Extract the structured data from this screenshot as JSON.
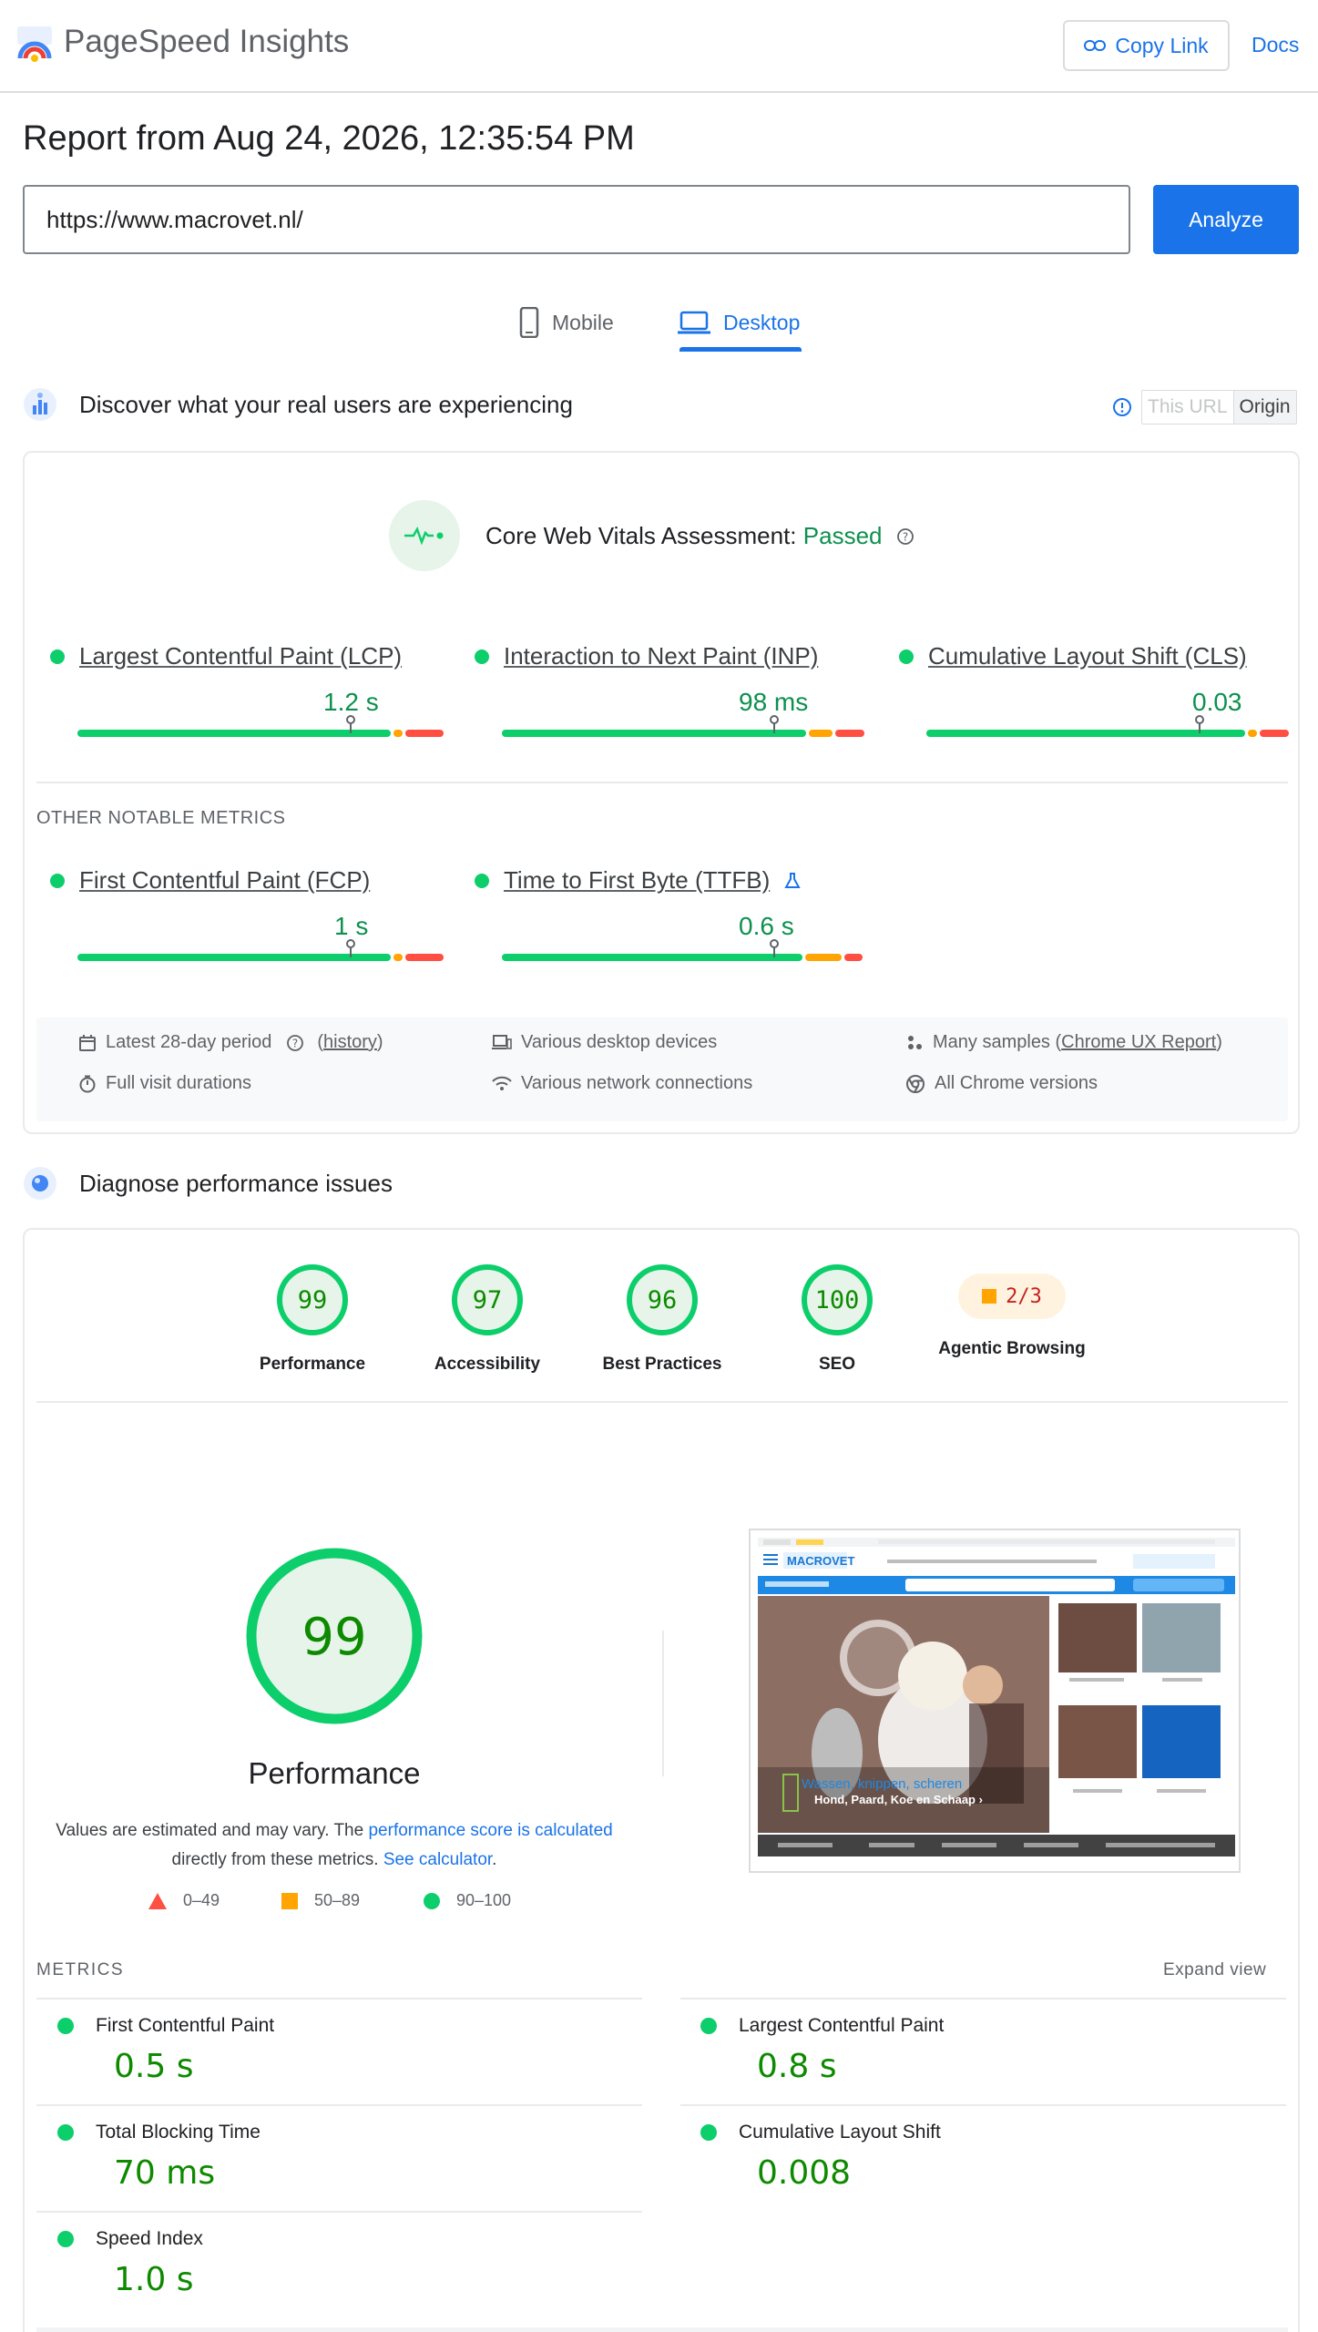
{
  "header": {
    "title": "PageSpeed Insights",
    "copy_link": "Copy Link",
    "docs": "Docs"
  },
  "report": {
    "title": "Report from Aug 24, 2026, 12:35:54 PM",
    "url": "https://www.macrovet.nl/",
    "analyze": "Analyze"
  },
  "tabs": {
    "mobile": "Mobile",
    "desktop": "Desktop",
    "active": "desktop"
  },
  "field": {
    "heading": "Discover what your real users are experiencing",
    "toggle_this_url": "This URL",
    "toggle_origin": "Origin",
    "assessment_label": "Core Web Vitals Assessment:",
    "assessment_status": "Passed",
    "metrics": [
      {
        "name": "Largest Contentful Paint (LCP)",
        "value": "1.2 s"
      },
      {
        "name": "Interaction to Next Paint (INP)",
        "value": "98 ms"
      },
      {
        "name": "Cumulative Layout Shift (CLS)",
        "value": "0.03"
      }
    ],
    "other_label": "OTHER NOTABLE METRICS",
    "other_metrics": [
      {
        "name": "First Contentful Paint (FCP)",
        "value": "1 s"
      },
      {
        "name": "Time to First Byte (TTFB)",
        "value": "0.6 s"
      }
    ],
    "info": {
      "period": "Latest 28-day period",
      "history": "history",
      "devices": "Various desktop devices",
      "samples_prefix": "Many samples (",
      "samples_link": "Chrome UX Report",
      "samples_suffix": ")",
      "durations": "Full visit durations",
      "network": "Various network connections",
      "chrome": "All Chrome versions"
    }
  },
  "diagnose": {
    "heading": "Diagnose performance issues",
    "scores": [
      {
        "label": "Performance",
        "score": "99"
      },
      {
        "label": "Accessibility",
        "score": "97"
      },
      {
        "label": "Best Practices",
        "score": "96"
      },
      {
        "label": "SEO",
        "score": "100"
      }
    ],
    "agentic": {
      "label": "Agentic Browsing",
      "value": "2/3"
    },
    "perf_score": "99",
    "perf_title": "Performance",
    "note_prefix": "Values are estimated and may vary. The ",
    "note_link1": "performance score is calculated",
    "note_middle": " directly from these metrics. ",
    "note_link2": "See calculator",
    "note_suffix": ".",
    "legend": {
      "poor": "0–49",
      "avg": "50–89",
      "good": "90–100"
    },
    "screenshot": {
      "brand": "MACROVET",
      "headline": "Wassen, knippen, scheren",
      "sub": "Hond, Paard, Koe en Schaap ›"
    },
    "metrics_label": "METRICS",
    "expand": "Expand view",
    "lab_metrics": [
      {
        "name": "First Contentful Paint",
        "value": "0.5 s"
      },
      {
        "name": "Largest Contentful Paint",
        "value": "0.8 s"
      },
      {
        "name": "Total Blocking Time",
        "value": "70 ms"
      },
      {
        "name": "Cumulative Layout Shift",
        "value": "0.008"
      },
      {
        "name": "Speed Index",
        "value": "1.0 s"
      }
    ]
  }
}
